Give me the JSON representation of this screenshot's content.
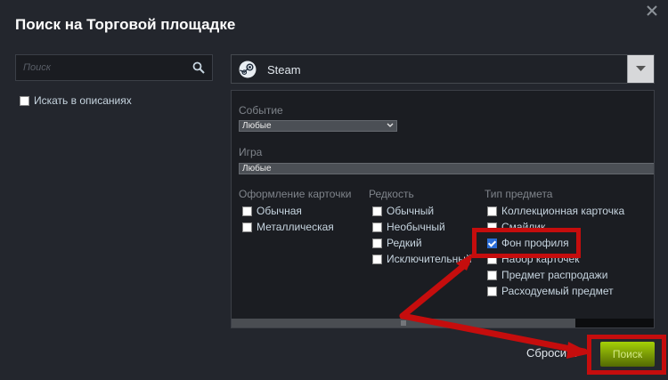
{
  "dialog": {
    "title": "Поиск на Торговой площадке",
    "close_icon": "close-icon"
  },
  "search": {
    "placeholder": "Поиск",
    "value": "",
    "icon": "search-icon",
    "search_descriptions_label": "Искать в описаниях",
    "search_descriptions_checked": false
  },
  "app_select": {
    "icon": "steam-logo-icon",
    "selected": "Steam"
  },
  "filters": {
    "event": {
      "label": "Событие",
      "selected": "Любые"
    },
    "game": {
      "label": "Игра",
      "selected": "Любые"
    },
    "columns": [
      {
        "header": "Оформление карточки",
        "options": [
          {
            "label": "Обычная",
            "checked": false
          },
          {
            "label": "Металлическая",
            "checked": false
          }
        ]
      },
      {
        "header": "Редкость",
        "options": [
          {
            "label": "Обычный",
            "checked": false
          },
          {
            "label": "Необычный",
            "checked": false
          },
          {
            "label": "Редкий",
            "checked": false
          },
          {
            "label": "Исключительный",
            "checked": false
          }
        ]
      },
      {
        "header": "Тип предмета",
        "options": [
          {
            "label": "Коллекционная карточка",
            "checked": false
          },
          {
            "label": "Смайлик",
            "checked": false
          },
          {
            "label": "Фон профиля",
            "checked": true
          },
          {
            "label": "Набор карточек",
            "checked": false
          },
          {
            "label": "Предмет распродажи",
            "checked": false
          },
          {
            "label": "Расходуемый предмет",
            "checked": false
          }
        ]
      }
    ]
  },
  "actions": {
    "reset_label": "Сбросить",
    "search_label": "Поиск"
  },
  "colors": {
    "annotation_red": "#c50d0d",
    "search_button_green": "#a4d007",
    "background": "#23262d"
  }
}
